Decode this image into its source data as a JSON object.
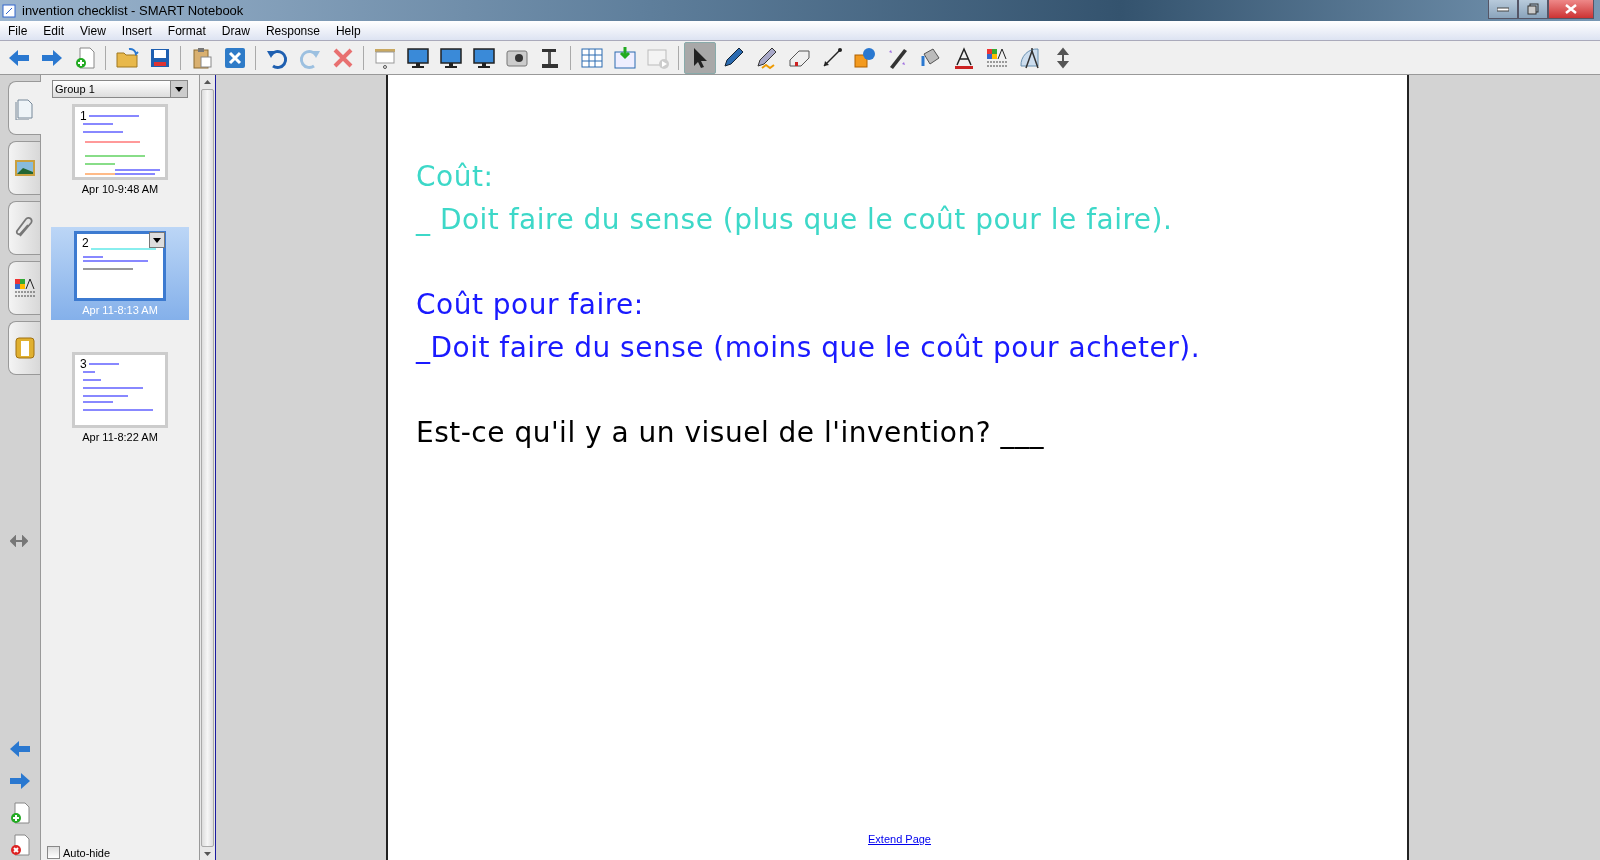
{
  "window": {
    "title": "invention checklist - SMART Notebook"
  },
  "menu": [
    "File",
    "Edit",
    "View",
    "Insert",
    "Format",
    "Draw",
    "Response",
    "Help"
  ],
  "toolbar": [
    [
      {
        "kind": "back",
        "selected": false
      },
      {
        "kind": "forward",
        "selected": false
      },
      {
        "kind": "newpage",
        "selected": false
      }
    ],
    [
      {
        "kind": "open",
        "selected": false
      },
      {
        "kind": "save",
        "selected": false
      }
    ],
    [
      {
        "kind": "paste",
        "selected": false
      },
      {
        "kind": "fullscreenexit",
        "selected": false
      }
    ],
    [
      {
        "kind": "undo",
        "selected": false
      },
      {
        "kind": "redo",
        "selected": false
      },
      {
        "kind": "delete",
        "selected": false
      }
    ],
    [
      {
        "kind": "screen",
        "selected": false
      },
      {
        "kind": "monitor",
        "selected": false
      },
      {
        "kind": "monitor",
        "selected": false
      },
      {
        "kind": "monitor",
        "selected": false
      },
      {
        "kind": "camera",
        "selected": false
      },
      {
        "kind": "doccam",
        "selected": false
      }
    ],
    [
      {
        "kind": "table",
        "selected": false
      },
      {
        "kind": "import",
        "selected": false
      },
      {
        "kind": "play",
        "selected": false
      }
    ],
    [
      {
        "kind": "select",
        "selected": true
      },
      {
        "kind": "pen",
        "selected": false
      },
      {
        "kind": "highlighter",
        "selected": false
      },
      {
        "kind": "eraser",
        "selected": false
      },
      {
        "kind": "line",
        "selected": false
      },
      {
        "kind": "shapes",
        "selected": false
      },
      {
        "kind": "magicpen",
        "selected": false
      },
      {
        "kind": "fill",
        "selected": false
      },
      {
        "kind": "text",
        "selected": false
      },
      {
        "kind": "properties",
        "selected": false
      },
      {
        "kind": "compass",
        "selected": false
      },
      {
        "kind": "updown",
        "selected": false
      }
    ]
  ],
  "side_tabs": [
    {
      "kind": "pages",
      "selected": true
    },
    {
      "kind": "gallery",
      "selected": false
    },
    {
      "kind": "attachments",
      "selected": false
    },
    {
      "kind": "properties",
      "selected": false
    },
    {
      "kind": "response",
      "selected": false
    }
  ],
  "sorter": {
    "group": "Group 1",
    "pages": [
      {
        "number": "1",
        "time": "Apr 10-9:48 AM",
        "selected": false
      },
      {
        "number": "2",
        "time": "Apr 11-8:13 AM",
        "selected": true
      },
      {
        "number": "3",
        "time": "Apr 11-8:22 AM",
        "selected": false
      }
    ],
    "auto_hide": {
      "label": "Auto-hide",
      "checked": false
    }
  },
  "page": {
    "paragraphs": [
      {
        "color": "#3dd8c8",
        "lines": [
          "Coût:",
          "_ Doit faire du sense (plus que le coût pour le faire)."
        ]
      },
      {
        "color": "#1a1aff",
        "lines": [
          "Coût pour faire:",
          "_Doit faire du sense (moins que le coût pour acheter)."
        ]
      },
      {
        "color": "#000000",
        "lines": [
          "Est-ce qu'il y a un visuel de l'invention? ___"
        ]
      }
    ],
    "extend_link": "Extend Page"
  }
}
